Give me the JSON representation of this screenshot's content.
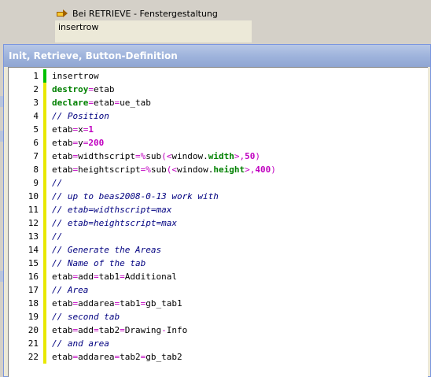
{
  "background": {
    "link_label": "Bei RETRIEVE - Fenstergestaltung",
    "field_value": "insertrow"
  },
  "window": {
    "title": "Init, Retrieve, Button-Definition"
  },
  "editor": {
    "lines": [
      {
        "n": "1",
        "tokens": [
          [
            "plain",
            "insertrow"
          ]
        ]
      },
      {
        "n": "2",
        "tokens": [
          [
            "kw",
            "destroy"
          ],
          [
            "op",
            "="
          ],
          [
            "plain",
            "etab"
          ]
        ]
      },
      {
        "n": "3",
        "tokens": [
          [
            "kw",
            "declare"
          ],
          [
            "op",
            "="
          ],
          [
            "plain",
            "etab"
          ],
          [
            "op",
            "="
          ],
          [
            "plain",
            "ue_tab"
          ]
        ]
      },
      {
        "n": "4",
        "tokens": [
          [
            "cm",
            "// Position"
          ]
        ]
      },
      {
        "n": "5",
        "tokens": [
          [
            "plain",
            "etab"
          ],
          [
            "op",
            "="
          ],
          [
            "plain",
            "x"
          ],
          [
            "op",
            "="
          ],
          [
            "num",
            "1"
          ]
        ]
      },
      {
        "n": "6",
        "tokens": [
          [
            "plain",
            "etab"
          ],
          [
            "op",
            "="
          ],
          [
            "plain",
            "y"
          ],
          [
            "op",
            "="
          ],
          [
            "num",
            "200"
          ]
        ]
      },
      {
        "n": "7",
        "tokens": [
          [
            "plain",
            "etab"
          ],
          [
            "op",
            "="
          ],
          [
            "plain",
            "widthscript"
          ],
          [
            "op",
            "=%"
          ],
          [
            "plain",
            "sub"
          ],
          [
            "op",
            "(<"
          ],
          [
            "plain",
            "window."
          ],
          [
            "var",
            "width"
          ],
          [
            "op",
            ">,"
          ],
          [
            "num",
            "50"
          ],
          [
            "op",
            ")"
          ]
        ]
      },
      {
        "n": "8",
        "tokens": [
          [
            "plain",
            "etab"
          ],
          [
            "op",
            "="
          ],
          [
            "plain",
            "heightscript"
          ],
          [
            "op",
            "=%"
          ],
          [
            "plain",
            "sub"
          ],
          [
            "op",
            "(<"
          ],
          [
            "plain",
            "window."
          ],
          [
            "var",
            "height"
          ],
          [
            "op",
            ">,"
          ],
          [
            "num",
            "400"
          ],
          [
            "op",
            ")"
          ]
        ]
      },
      {
        "n": "9",
        "tokens": [
          [
            "cm",
            "//"
          ]
        ]
      },
      {
        "n": "10",
        "tokens": [
          [
            "cm",
            "// up to beas2008-0-13 work with"
          ]
        ]
      },
      {
        "n": "11",
        "tokens": [
          [
            "cm",
            "// etab=widthscript=max"
          ]
        ]
      },
      {
        "n": "12",
        "tokens": [
          [
            "cm",
            "// etab=heightscript=max"
          ]
        ]
      },
      {
        "n": "13",
        "tokens": [
          [
            "cm",
            "//"
          ]
        ]
      },
      {
        "n": "14",
        "tokens": [
          [
            "cm",
            "// Generate the Areas"
          ]
        ]
      },
      {
        "n": "15",
        "tokens": [
          [
            "cm",
            "// Name of the tab"
          ]
        ]
      },
      {
        "n": "16",
        "tokens": [
          [
            "plain",
            "etab"
          ],
          [
            "op",
            "="
          ],
          [
            "plain",
            "add"
          ],
          [
            "op",
            "="
          ],
          [
            "plain",
            "tab1"
          ],
          [
            "op",
            "="
          ],
          [
            "plain",
            "Additional"
          ]
        ]
      },
      {
        "n": "17",
        "tokens": [
          [
            "cm",
            "// Area"
          ]
        ]
      },
      {
        "n": "18",
        "tokens": [
          [
            "plain",
            "etab"
          ],
          [
            "op",
            "="
          ],
          [
            "plain",
            "addarea"
          ],
          [
            "op",
            "="
          ],
          [
            "plain",
            "tab1"
          ],
          [
            "op",
            "="
          ],
          [
            "plain",
            "gb_tab1"
          ]
        ]
      },
      {
        "n": "19",
        "tokens": [
          [
            "cm",
            "// second tab"
          ]
        ]
      },
      {
        "n": "20",
        "tokens": [
          [
            "plain",
            "etab"
          ],
          [
            "op",
            "="
          ],
          [
            "plain",
            "add"
          ],
          [
            "op",
            "="
          ],
          [
            "plain",
            "tab2"
          ],
          [
            "op",
            "="
          ],
          [
            "plain",
            "Drawing"
          ],
          [
            "op",
            "-"
          ],
          [
            "plain",
            "Info"
          ]
        ]
      },
      {
        "n": "21",
        "tokens": [
          [
            "cm",
            "// and area"
          ]
        ]
      },
      {
        "n": "22",
        "tokens": [
          [
            "plain",
            "etab"
          ],
          [
            "op",
            "="
          ],
          [
            "plain",
            "addarea"
          ],
          [
            "op",
            "="
          ],
          [
            "plain",
            "tab2"
          ],
          [
            "op",
            "="
          ],
          [
            "plain",
            "gb_tab2"
          ]
        ]
      }
    ]
  },
  "colors": {
    "keyword": "#008000",
    "operator": "#c000c0",
    "comment": "#000080",
    "change_marker": "#e8e800",
    "current_marker": "#00c000"
  }
}
